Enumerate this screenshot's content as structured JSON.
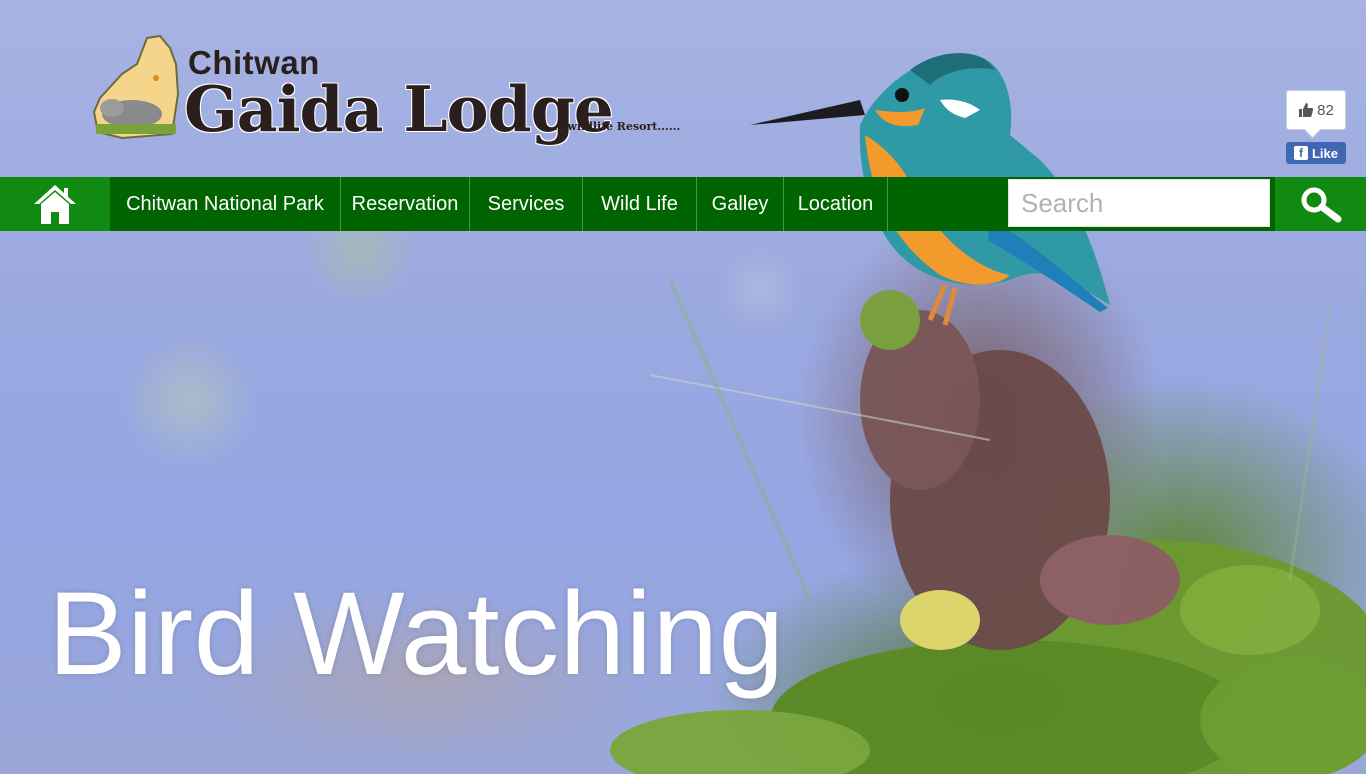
{
  "logo": {
    "line1": "Chitwan",
    "line2": "Gaida Lodge",
    "tagline": "A wildlife Resort......"
  },
  "social": {
    "like_count": "82",
    "like_button_label": "Like"
  },
  "nav": {
    "home_icon": "home-icon",
    "items": [
      {
        "label": "Chitwan National Park"
      },
      {
        "label": "Reservation"
      },
      {
        "label": "Services"
      },
      {
        "label": "Wild Life"
      },
      {
        "label": "Galley"
      },
      {
        "label": "Location"
      }
    ],
    "search": {
      "placeholder": "Search",
      "value": ""
    },
    "search_icon": "search-icon"
  },
  "hero": {
    "title": "Bird Watching"
  },
  "colors": {
    "nav_bg": "#006400",
    "nav_active": "#118a11",
    "facebook": "#4267b2"
  }
}
